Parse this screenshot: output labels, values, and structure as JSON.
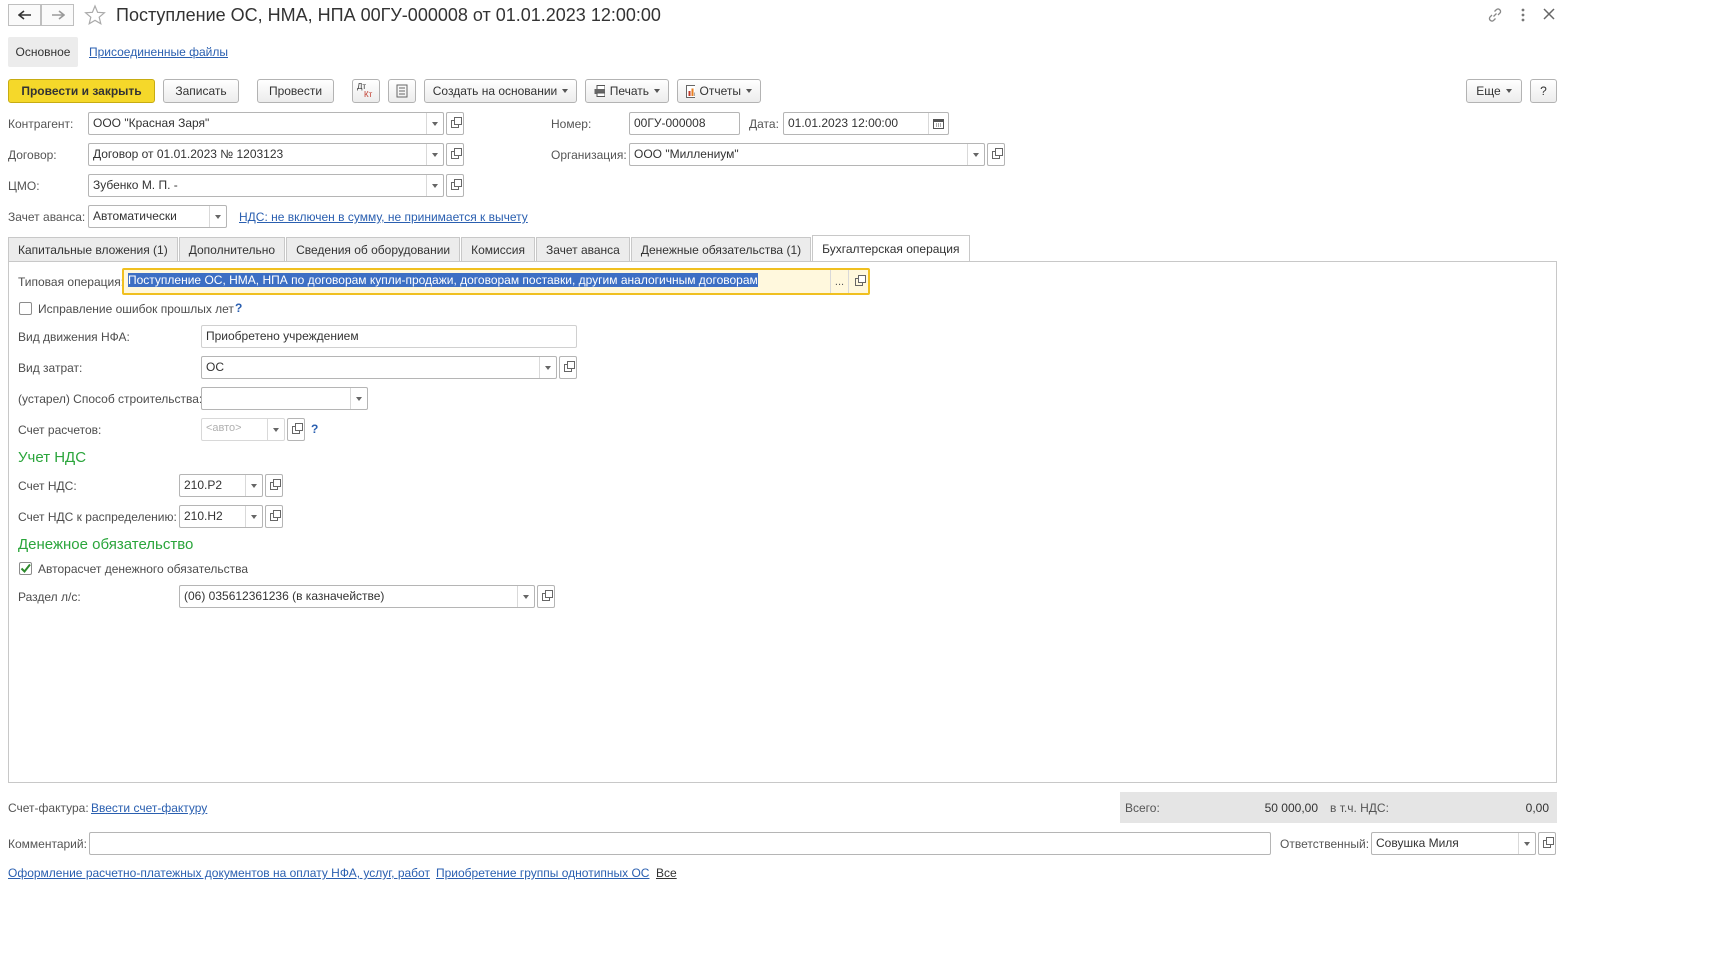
{
  "window": {
    "title": "Поступление ОС, НМА, НПА 00ГУ-000008 от 01.01.2023 12:00:00",
    "link_icon": "link-icon",
    "more_icon": "kebab-menu-icon",
    "close_icon": "close-icon"
  },
  "nav_tabs": {
    "main": "Основное",
    "files": "Присоединенные файлы"
  },
  "toolbar": {
    "post_close": "Провести и закрыть",
    "save": "Записать",
    "post": "Провести",
    "dt_kt_top": "Дт",
    "dt_kt_bottom": "Кт",
    "create_based": "Создать на основании",
    "print": "Печать",
    "reports": "Отчеты",
    "more": "Еще",
    "help": "?"
  },
  "header": {
    "contractor_label": "Контрагент:",
    "contractor_value": "ООО \"Красная Заря\"",
    "contract_label": "Договор:",
    "contract_value": "Договор от 01.01.2023 № 1203123",
    "cmo_label": "ЦМО:",
    "cmo_value": "Зубенко М. П. -",
    "advance_label": "Зачет аванса:",
    "advance_value": "Автоматически",
    "vat_link": "НДС: не включен в сумму, не принимается к вычету",
    "number_label": "Номер:",
    "number_value": "00ГУ-000008",
    "date_label": "Дата:",
    "date_value": "01.01.2023 12:00:00",
    "org_label": "Организация:",
    "org_value": "ООО \"Миллениум\""
  },
  "tabs": [
    {
      "label": "Капитальные вложения (1)"
    },
    {
      "label": "Дополнительно"
    },
    {
      "label": "Сведения об оборудовании"
    },
    {
      "label": "Комиссия"
    },
    {
      "label": "Зачет аванса"
    },
    {
      "label": "Денежные обязательства (1)"
    },
    {
      "label": "Бухгалтерская операция"
    }
  ],
  "active_tab": "Бухгалтерская операция",
  "accounting": {
    "typical_op_label": "Типовая операция:",
    "typical_op_value": "Поступление ОС, НМА, НПА по договорам купли-продажи, договорам поставки, другим аналогичным договорам",
    "typical_op_dots": "...",
    "fix_errors_label": "Исправление ошибок прошлых лет",
    "fix_errors_checked": false,
    "help_mark": "?",
    "movement_label": "Вид движения НФА:",
    "movement_value": "Приобретено учреждением",
    "cost_type_label": "Вид затрат:",
    "cost_type_value": "ОС",
    "build_method_label": "(устарел) Способ строительства:",
    "build_method_value": "",
    "settlement_label": "Счет расчетов:",
    "settlement_placeholder": "<авто>",
    "vat_section": "Учет НДС",
    "vat_account_label": "Счет НДС:",
    "vat_account_value": "210.Р2",
    "vat_dist_label": "Счет НДС к распределению:",
    "vat_dist_value": "210.Н2",
    "money_section": "Денежное обязательство",
    "auto_calc_label": "Авторасчет денежного обязательства",
    "auto_calc_checked": true,
    "section_label": "Раздел л/с:",
    "section_value": "(06) 035612361236 (в казначействе)"
  },
  "footer": {
    "invoice_label": "Счет-фактура:",
    "invoice_link": "Ввести счет-фактуру",
    "total_label": "Всего:",
    "total_value": "50 000,00",
    "vat_incl_label": "в т.ч. НДС:",
    "vat_incl_value": "0,00",
    "comment_label": "Комментарий:",
    "comment_value": "",
    "responsible_label": "Ответственный:",
    "responsible_value": "Совушка Миля",
    "link1": "Оформление расчетно-платежных документов на оплату НФА, услуг, работ",
    "link2": "Приобретение группы однотипных ОС",
    "link3": "Все"
  },
  "colors": {
    "primary_button": "#f5d82a",
    "section_green": "#2aa53b",
    "link_blue": "#2a5fb0",
    "selection_bg": "#3d6fc4",
    "focus_border": "#f0c020"
  }
}
